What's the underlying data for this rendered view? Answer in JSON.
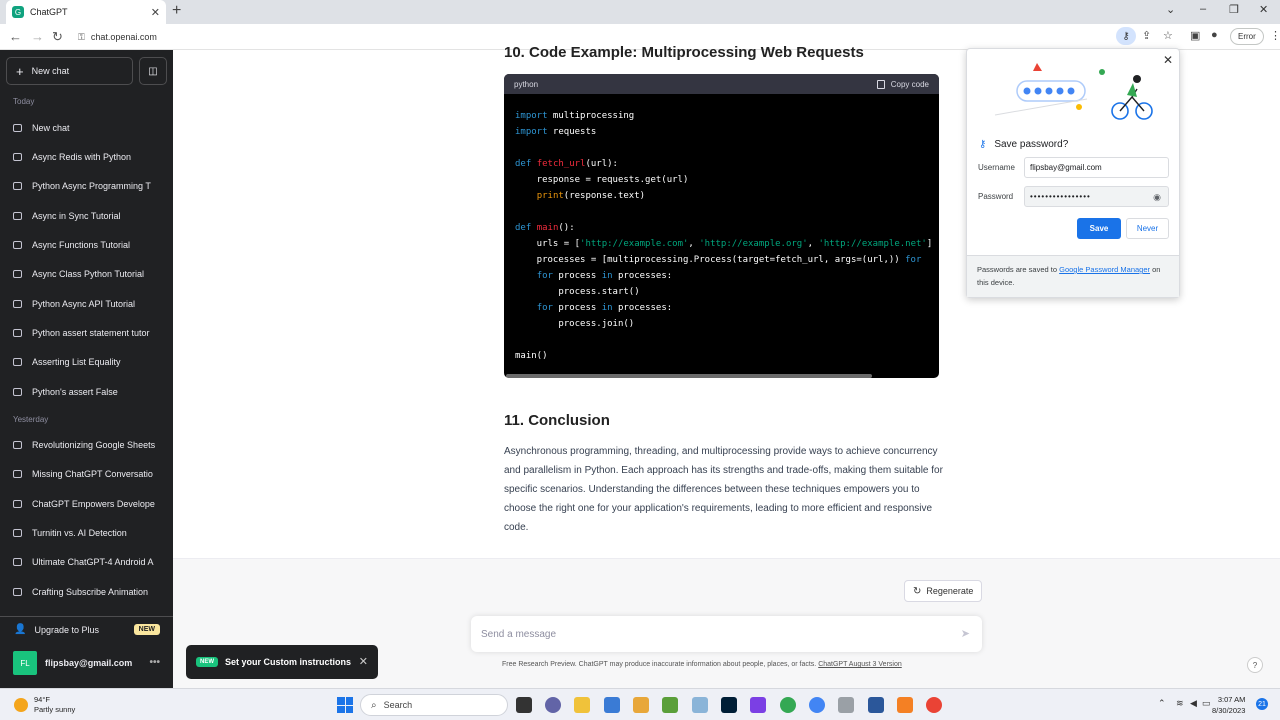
{
  "browser": {
    "tab_title": "ChatGPT",
    "tab_favicon": "G",
    "url": "chat.openai.com",
    "error_label": "Error"
  },
  "sidebar": {
    "new_chat": "New chat",
    "today_label": "Today",
    "today": [
      "New chat",
      "Async Redis with Python",
      "Python Async Programming T",
      "Async in Sync Tutorial",
      "Async Functions Tutorial",
      "Async Class Python Tutorial",
      "Python Async API Tutorial",
      "Python assert statement tutor",
      "Asserting List Equality",
      "Python's assert False"
    ],
    "yesterday_label": "Yesterday",
    "yesterday": [
      "Revolutionizing Google Sheets",
      "Missing ChatGPT Conversatio",
      "ChatGPT Empowers Develope",
      "Turnitin vs. AI Detection",
      "Ultimate ChatGPT-4 Android A",
      "Crafting Subscribe Animation"
    ],
    "upgrade": "Upgrade to Plus",
    "upgrade_badge": "NEW",
    "avatar_initials": "FL",
    "account_email": "flipsbay@gmail.com"
  },
  "content": {
    "heading_10": "10. Code Example: Multiprocessing Web Requests",
    "code_lang": "python",
    "copy_code": "Copy code",
    "heading_11": "11. Conclusion",
    "conclusion": "Asynchronous programming, threading, and multiprocessing provide ways to achieve concurrency and parallelism in Python. Each approach has its strengths and trade-offs, making them suitable for specific scenarios. Understanding the differences between these techniques empowers you to choose the right one for your application's requirements, leading to more efficient and responsive code."
  },
  "composer": {
    "regenerate": "Regenerate",
    "placeholder": "Send a message",
    "disclaimer": "Free Research Preview. ChatGPT may produce inaccurate information about people, places, or facts. ",
    "disclaimer_link": "ChatGPT August 3 Version",
    "help": "?"
  },
  "toast": {
    "badge": "NEW",
    "text": "Set your Custom instructions"
  },
  "password_popup": {
    "title": "Save password?",
    "username_label": "Username",
    "username_value": "flipsbay@gmail.com",
    "password_label": "Password",
    "password_value": "••••••••••••••••",
    "save": "Save",
    "never": "Never",
    "footer_prefix": "Passwords are saved to ",
    "footer_link": "Google Password Manager",
    "footer_suffix": " on this device."
  },
  "taskbar": {
    "temperature": "94°F",
    "condition": "Partly sunny",
    "search": "Search",
    "time": "3:07 AM",
    "date": "8/30/2023",
    "notifications": "21"
  },
  "colors": {
    "sidebar_bg": "#202123",
    "accent_green": "#10a37f",
    "chrome_blue": "#1a73e8"
  }
}
